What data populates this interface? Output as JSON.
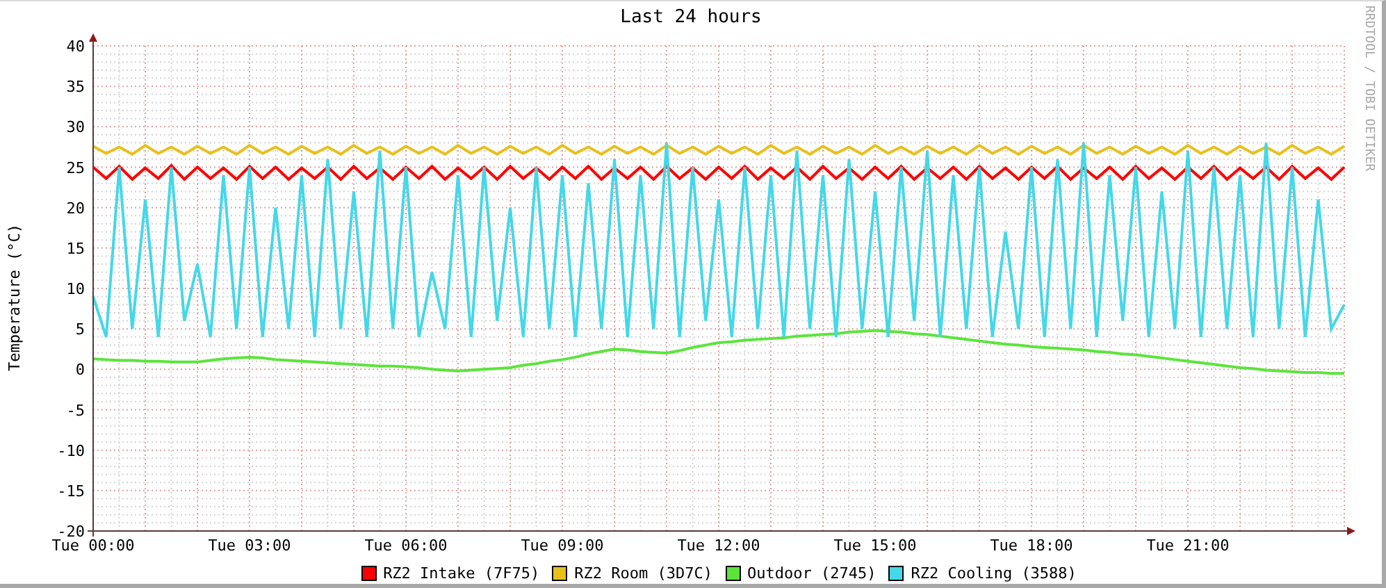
{
  "credit": "RRDTOOL / TOBI OETIKER",
  "chart_data": {
    "type": "line",
    "title": "Last 24 hours",
    "ylabel": "Temperature (°C)",
    "categories": [
      "Tue 00:00",
      null,
      null,
      null,
      null,
      null,
      null,
      null,
      null,
      null,
      null,
      null,
      "Tue 03:00",
      null,
      null,
      null,
      null,
      null,
      null,
      null,
      null,
      null,
      null,
      null,
      "Tue 06:00",
      null,
      null,
      null,
      null,
      null,
      null,
      null,
      null,
      null,
      null,
      null,
      "Tue 09:00",
      null,
      null,
      null,
      null,
      null,
      null,
      null,
      null,
      null,
      null,
      null,
      "Tue 12:00",
      null,
      null,
      null,
      null,
      null,
      null,
      null,
      null,
      null,
      null,
      null,
      "Tue 15:00",
      null,
      null,
      null,
      null,
      null,
      null,
      null,
      null,
      null,
      null,
      null,
      "Tue 18:00",
      null,
      null,
      null,
      null,
      null,
      null,
      null,
      null,
      null,
      null,
      null,
      "Tue 21:00",
      null,
      null,
      null,
      null,
      null,
      null,
      null,
      null,
      null,
      null,
      null,
      null
    ],
    "ylim": [
      -20,
      40
    ],
    "grid": true,
    "yticks": [
      -20,
      -15,
      -10,
      -5,
      0,
      5,
      10,
      15,
      20,
      25,
      30,
      35,
      40
    ],
    "series": [
      {
        "name": "RZ2 Intake (7F75)",
        "color": "#ff0000",
        "values": [
          25.0,
          23.6,
          25.1,
          23.5,
          24.9,
          23.6,
          25.2,
          23.5,
          25.0,
          23.6,
          24.9,
          23.5,
          25.1,
          23.6,
          25.0,
          23.5,
          24.9,
          23.6,
          25.0,
          23.5,
          25.1,
          23.6,
          24.9,
          23.5,
          25.0,
          23.6,
          25.1,
          23.5,
          24.9,
          23.6,
          25.0,
          23.5,
          25.1,
          23.6,
          24.9,
          23.5,
          25.0,
          23.6,
          25.1,
          23.5,
          24.9,
          23.6,
          25.0,
          23.5,
          25.1,
          23.6,
          24.9,
          23.5,
          25.0,
          23.6,
          25.1,
          23.5,
          24.9,
          23.6,
          25.0,
          23.5,
          25.1,
          23.6,
          24.9,
          23.5,
          25.0,
          23.6,
          25.1,
          23.5,
          24.9,
          23.6,
          25.0,
          23.5,
          25.1,
          23.6,
          24.9,
          23.5,
          25.0,
          23.6,
          25.1,
          23.5,
          24.9,
          23.6,
          25.0,
          23.5,
          25.1,
          23.6,
          24.9,
          23.5,
          25.0,
          23.6,
          25.1,
          23.5,
          24.9,
          23.6,
          25.0,
          23.5,
          25.1,
          23.6,
          24.9,
          23.5,
          25.0
        ]
      },
      {
        "name": "RZ2 Room (3D7C)",
        "color": "#e8c01c",
        "values": [
          27.6,
          26.7,
          27.5,
          26.6,
          27.7,
          26.7,
          27.5,
          26.6,
          27.6,
          26.7,
          27.5,
          26.6,
          27.7,
          26.7,
          27.5,
          26.6,
          27.6,
          26.7,
          27.5,
          26.6,
          27.7,
          26.7,
          27.5,
          26.6,
          27.6,
          26.7,
          27.5,
          26.6,
          27.7,
          26.7,
          27.5,
          26.6,
          27.6,
          26.7,
          27.5,
          26.6,
          27.7,
          26.7,
          27.5,
          26.6,
          27.6,
          26.7,
          27.5,
          26.6,
          27.7,
          26.7,
          27.5,
          26.6,
          27.6,
          26.7,
          27.5,
          26.6,
          27.7,
          26.7,
          27.5,
          26.6,
          27.6,
          26.7,
          27.5,
          26.6,
          27.7,
          26.7,
          27.5,
          26.6,
          27.6,
          26.7,
          27.5,
          26.6,
          27.7,
          26.7,
          27.5,
          26.6,
          27.6,
          26.7,
          27.5,
          26.6,
          27.7,
          26.7,
          27.5,
          26.6,
          27.6,
          26.7,
          27.5,
          26.6,
          27.7,
          26.7,
          27.5,
          26.6,
          27.6,
          26.7,
          27.5,
          26.6,
          27.7,
          26.7,
          27.5,
          26.6,
          27.6
        ]
      },
      {
        "name": "Outdoor (2745)",
        "color": "#5ce43c",
        "values": [
          1.3,
          1.2,
          1.1,
          1.1,
          1.0,
          1.0,
          0.9,
          0.9,
          0.9,
          1.1,
          1.3,
          1.4,
          1.5,
          1.4,
          1.2,
          1.1,
          1.0,
          0.9,
          0.8,
          0.7,
          0.6,
          0.5,
          0.4,
          0.4,
          0.3,
          0.2,
          0.0,
          -0.1,
          -0.2,
          -0.1,
          0.0,
          0.1,
          0.2,
          0.5,
          0.7,
          1.0,
          1.2,
          1.5,
          1.9,
          2.2,
          2.5,
          2.4,
          2.2,
          2.1,
          2.0,
          2.3,
          2.7,
          3.0,
          3.3,
          3.4,
          3.6,
          3.7,
          3.8,
          3.9,
          4.1,
          4.2,
          4.3,
          4.4,
          4.6,
          4.7,
          4.8,
          4.7,
          4.6,
          4.4,
          4.3,
          4.1,
          3.9,
          3.7,
          3.5,
          3.3,
          3.1,
          3.0,
          2.8,
          2.7,
          2.6,
          2.5,
          2.4,
          2.2,
          2.1,
          1.9,
          1.8,
          1.6,
          1.4,
          1.2,
          1.0,
          0.8,
          0.6,
          0.4,
          0.2,
          0.1,
          -0.1,
          -0.2,
          -0.3,
          -0.4,
          -0.4,
          -0.5,
          -0.5
        ]
      },
      {
        "name": "RZ2 Cooling (3588)",
        "color": "#44d8e8",
        "values": [
          9,
          4,
          25,
          5,
          21,
          4,
          25,
          6,
          13,
          4,
          24,
          5,
          25,
          4,
          20,
          5,
          24,
          4,
          26,
          5,
          22,
          4,
          27,
          5,
          25,
          4,
          12,
          5,
          24,
          4,
          25,
          6,
          20,
          4,
          25,
          5,
          24,
          4,
          23,
          5,
          26,
          4,
          24,
          5,
          28,
          4,
          25,
          6,
          21,
          4,
          25,
          5,
          24,
          4,
          27,
          5,
          24,
          4,
          26,
          5,
          22,
          4,
          25,
          6,
          27,
          4,
          24,
          5,
          25,
          4,
          17,
          5,
          25,
          4,
          26,
          5,
          28,
          4,
          24,
          6,
          25,
          4,
          22,
          5,
          27,
          4,
          25,
          5,
          24,
          4,
          28,
          5,
          25,
          4,
          21,
          5,
          8
        ]
      }
    ]
  }
}
